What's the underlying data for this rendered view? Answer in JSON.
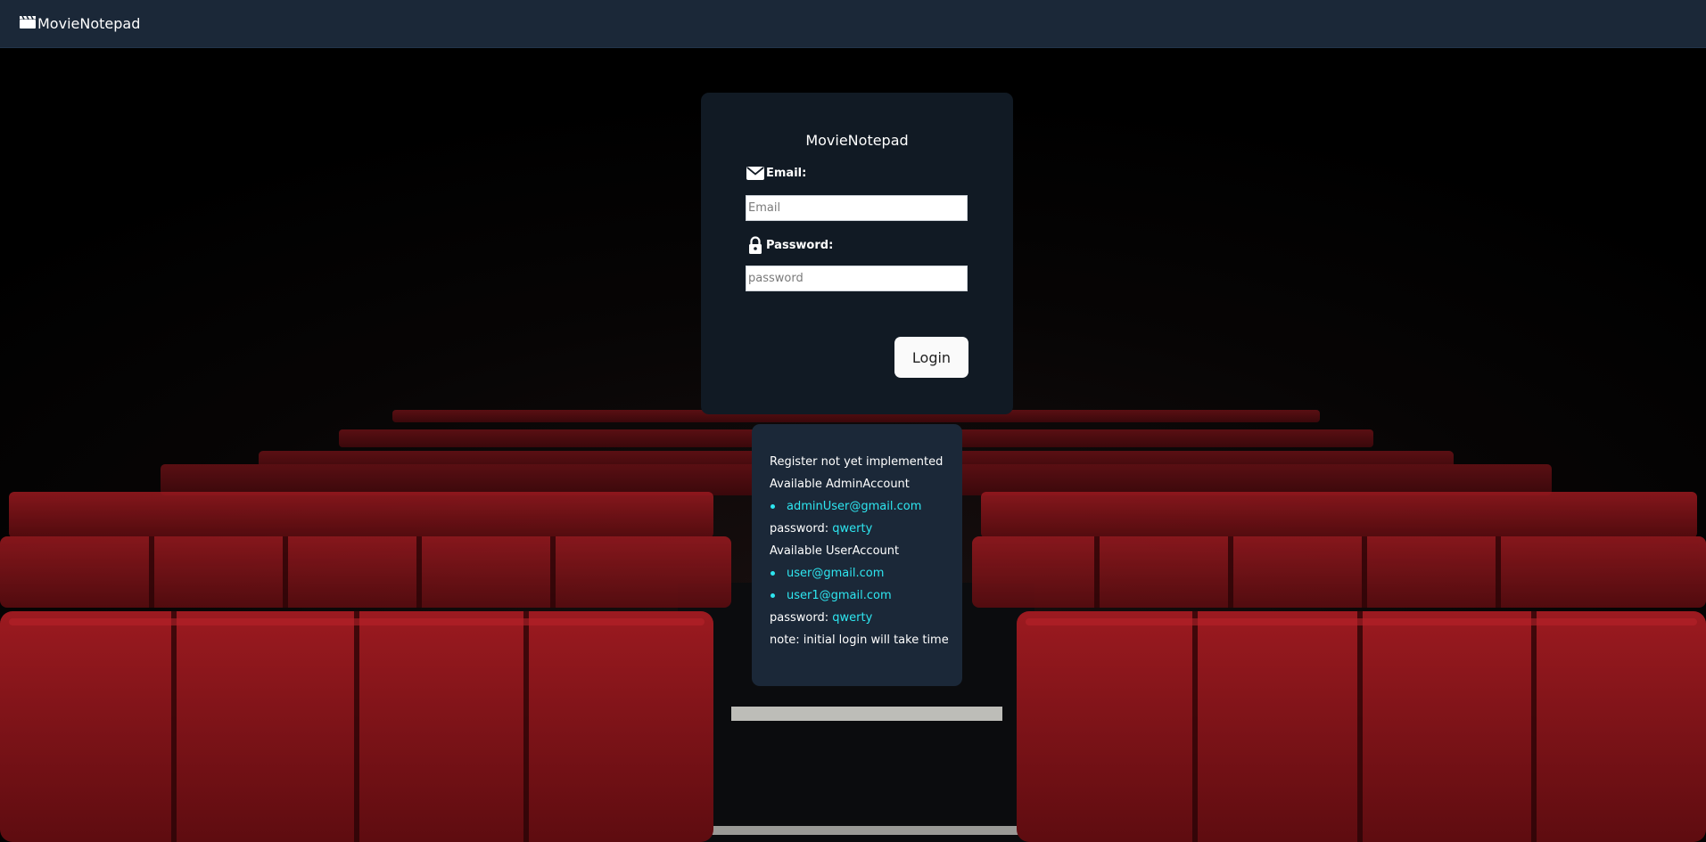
{
  "navbar": {
    "brand": "MovieNotepad",
    "brand_icon": "clapperboard-icon"
  },
  "login": {
    "title": "MovieNotepad",
    "email_label": "Email:",
    "email_icon": "envelope-icon",
    "email_placeholder": "Email",
    "email_value": "",
    "password_label": "Password:",
    "password_icon": "lock-icon",
    "password_placeholder": "password",
    "password_value": "",
    "submit_label": "Login"
  },
  "info": {
    "register_note": "Register not yet implemented",
    "admin_heading": "Available AdminAccount",
    "admin_emails": [
      "adminUser@gmail.com"
    ],
    "admin_password_label": "password:",
    "admin_password": "qwerty",
    "user_heading": "Available UserAccount",
    "user_emails": [
      "user@gmail.com",
      "user1@gmail.com"
    ],
    "user_password_label": "password:",
    "user_password": "qwerty",
    "note": "note: initial login will take time"
  },
  "colors": {
    "navbar_bg": "#1b2838",
    "card_bg": "#111a24",
    "info_bg": "#1b2838",
    "accent_cyan": "#2ee6f0",
    "seat_red": "#8a1419"
  }
}
